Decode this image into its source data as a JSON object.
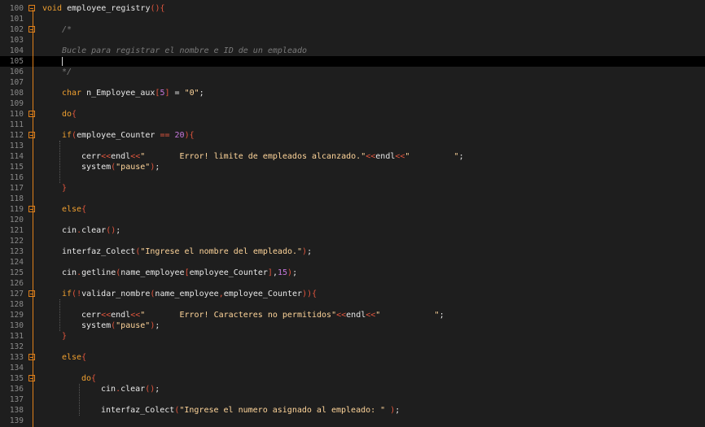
{
  "editor": {
    "lines": [
      {
        "n": "100",
        "fold": true,
        "indent": 0,
        "t": [
          [
            "k",
            "void"
          ],
          [
            "i",
            " employee_registry"
          ],
          [
            "p",
            "(){"
          ]
        ]
      },
      {
        "n": "101",
        "fold": false,
        "indent": 0,
        "t": []
      },
      {
        "n": "102",
        "fold": true,
        "indent": 1,
        "t": [
          [
            "cm",
            "/*"
          ]
        ]
      },
      {
        "n": "103",
        "fold": false,
        "indent": 1,
        "t": []
      },
      {
        "n": "104",
        "fold": false,
        "indent": 1,
        "t": [
          [
            "cm",
            "Bucle para registrar el nombre e ID de un empleado"
          ]
        ]
      },
      {
        "n": "105",
        "fold": false,
        "indent": 1,
        "t": [],
        "current": true
      },
      {
        "n": "106",
        "fold": false,
        "indent": 1,
        "t": [
          [
            "cm",
            "*/"
          ]
        ]
      },
      {
        "n": "107",
        "fold": false,
        "indent": 1,
        "t": []
      },
      {
        "n": "108",
        "fold": false,
        "indent": 1,
        "t": [
          [
            "k",
            "char"
          ],
          [
            "i",
            " n_Employee_aux"
          ],
          [
            "p",
            "["
          ],
          [
            "n",
            "5"
          ],
          [
            "p",
            "]"
          ],
          [
            "i",
            " = "
          ],
          [
            "s",
            "\"0\""
          ],
          [
            "i",
            ";"
          ]
        ]
      },
      {
        "n": "109",
        "fold": false,
        "indent": 1,
        "t": []
      },
      {
        "n": "110",
        "fold": true,
        "indent": 1,
        "t": [
          [
            "k",
            "do"
          ],
          [
            "p",
            "{"
          ]
        ]
      },
      {
        "n": "111",
        "fold": false,
        "indent": 1,
        "t": []
      },
      {
        "n": "112",
        "fold": true,
        "indent": 1,
        "t": [
          [
            "k",
            "if"
          ],
          [
            "p",
            "("
          ],
          [
            "i",
            "employee_Counter "
          ],
          [
            "p",
            "=="
          ],
          [
            "i",
            " "
          ],
          [
            "n",
            "20"
          ],
          [
            "p",
            ")"
          ],
          [
            "p",
            "{"
          ]
        ]
      },
      {
        "n": "113",
        "fold": false,
        "indent": 2,
        "t": []
      },
      {
        "n": "114",
        "fold": false,
        "indent": 2,
        "t": [
          [
            "i",
            "cerr"
          ],
          [
            "p",
            "<<"
          ],
          [
            "i",
            "endl"
          ],
          [
            "p",
            "<<"
          ],
          [
            "s",
            "\"       Error! limite de empleados alcanzado.\""
          ],
          [
            "p",
            "<<"
          ],
          [
            "i",
            "endl"
          ],
          [
            "p",
            "<<"
          ],
          [
            "s",
            "\"         \""
          ],
          [
            "i",
            ";"
          ]
        ]
      },
      {
        "n": "115",
        "fold": false,
        "indent": 2,
        "t": [
          [
            "i",
            "system"
          ],
          [
            "p",
            "("
          ],
          [
            "s",
            "\"pause\""
          ],
          [
            "p",
            ")"
          ],
          [
            "i",
            ";"
          ]
        ]
      },
      {
        "n": "116",
        "fold": false,
        "indent": 2,
        "t": []
      },
      {
        "n": "117",
        "fold": false,
        "indent": 1,
        "t": [
          [
            "p",
            "}"
          ]
        ]
      },
      {
        "n": "118",
        "fold": false,
        "indent": 1,
        "t": []
      },
      {
        "n": "119",
        "fold": true,
        "indent": 1,
        "t": [
          [
            "k",
            "else"
          ],
          [
            "p",
            "{"
          ]
        ]
      },
      {
        "n": "120",
        "fold": false,
        "indent": 1,
        "t": []
      },
      {
        "n": "121",
        "fold": false,
        "indent": 1,
        "t": [
          [
            "i",
            "cin"
          ],
          [
            "p",
            "."
          ],
          [
            "i",
            "clear"
          ],
          [
            "p",
            "()"
          ],
          [
            "i",
            ";"
          ]
        ]
      },
      {
        "n": "122",
        "fold": false,
        "indent": 1,
        "t": []
      },
      {
        "n": "123",
        "fold": false,
        "indent": 1,
        "t": [
          [
            "i",
            "interfaz_Colect"
          ],
          [
            "p",
            "("
          ],
          [
            "s",
            "\"Ingrese el nombre del empleado.\""
          ],
          [
            "p",
            ")"
          ],
          [
            "i",
            ";"
          ]
        ]
      },
      {
        "n": "124",
        "fold": false,
        "indent": 1,
        "t": []
      },
      {
        "n": "125",
        "fold": false,
        "indent": 1,
        "t": [
          [
            "i",
            "cin"
          ],
          [
            "p",
            "."
          ],
          [
            "i",
            "getline"
          ],
          [
            "p",
            "("
          ],
          [
            "i",
            "name_employee"
          ],
          [
            "p",
            "["
          ],
          [
            "i",
            "employee_Counter"
          ],
          [
            "p",
            "]"
          ],
          [
            "i",
            ","
          ],
          [
            "n",
            "15"
          ],
          [
            "p",
            ")"
          ],
          [
            "i",
            ";"
          ]
        ]
      },
      {
        "n": "126",
        "fold": false,
        "indent": 1,
        "t": []
      },
      {
        "n": "127",
        "fold": true,
        "indent": 1,
        "t": [
          [
            "k",
            "if"
          ],
          [
            "p",
            "(!"
          ],
          [
            "i",
            "validar_nombre"
          ],
          [
            "p",
            "("
          ],
          [
            "i",
            "name_employee"
          ],
          [
            "p",
            ","
          ],
          [
            "i",
            "employee_Counter"
          ],
          [
            "p",
            "))"
          ],
          [
            "p",
            "{"
          ]
        ]
      },
      {
        "n": "128",
        "fold": false,
        "indent": 2,
        "t": []
      },
      {
        "n": "129",
        "fold": false,
        "indent": 2,
        "t": [
          [
            "i",
            "cerr"
          ],
          [
            "p",
            "<<"
          ],
          [
            "i",
            "endl"
          ],
          [
            "p",
            "<<"
          ],
          [
            "s",
            "\"       Error! Caracteres no permitidos\""
          ],
          [
            "p",
            "<<"
          ],
          [
            "i",
            "endl"
          ],
          [
            "p",
            "<<"
          ],
          [
            "s",
            "\"           \""
          ],
          [
            "i",
            ";"
          ]
        ]
      },
      {
        "n": "130",
        "fold": false,
        "indent": 2,
        "t": [
          [
            "i",
            "system"
          ],
          [
            "p",
            "("
          ],
          [
            "s",
            "\"pause\""
          ],
          [
            "p",
            ")"
          ],
          [
            "i",
            ";"
          ]
        ]
      },
      {
        "n": "131",
        "fold": false,
        "indent": 1,
        "t": [
          [
            "p",
            "}"
          ]
        ]
      },
      {
        "n": "132",
        "fold": false,
        "indent": 1,
        "t": []
      },
      {
        "n": "133",
        "fold": true,
        "indent": 1,
        "t": [
          [
            "k",
            "else"
          ],
          [
            "p",
            "{"
          ]
        ]
      },
      {
        "n": "134",
        "fold": false,
        "indent": 2,
        "t": []
      },
      {
        "n": "135",
        "fold": true,
        "indent": 2,
        "t": [
          [
            "k",
            "do"
          ],
          [
            "p",
            "{"
          ]
        ]
      },
      {
        "n": "136",
        "fold": false,
        "indent": 3,
        "t": [
          [
            "i",
            "cin"
          ],
          [
            "p",
            "."
          ],
          [
            "i",
            "clear"
          ],
          [
            "p",
            "()"
          ],
          [
            "i",
            ";"
          ]
        ]
      },
      {
        "n": "137",
        "fold": false,
        "indent": 3,
        "t": []
      },
      {
        "n": "138",
        "fold": false,
        "indent": 3,
        "t": [
          [
            "i",
            "interfaz_Colect"
          ],
          [
            "p",
            "("
          ],
          [
            "s",
            "\"Ingrese el numero asignado al empleado: \""
          ],
          [
            "i",
            " "
          ],
          [
            "p",
            ")"
          ],
          [
            "i",
            ";"
          ]
        ]
      },
      {
        "n": "139",
        "fold": false,
        "indent": 3,
        "t": []
      }
    ]
  }
}
